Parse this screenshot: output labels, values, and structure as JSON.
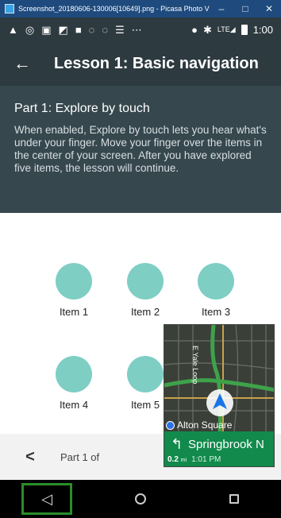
{
  "window": {
    "title": "Screenshot_20180606-130006[10649].png - Picasa Photo Viewer",
    "minimize_glyph": "–",
    "maximize_glyph": "□",
    "close_glyph": "✕"
  },
  "status_bar": {
    "icons": [
      "navigation-icon",
      "chrome-icon",
      "gmail-icon",
      "image-icon",
      "flag-icon",
      "location-icon",
      "location-icon",
      "keyboard-icon",
      "more-icon",
      "location-pin-icon",
      "bluetooth-icon",
      "signal-icon",
      "battery-icon"
    ],
    "lte": "LTE",
    "time": "1:00"
  },
  "toolbar": {
    "title": "Lesson 1: Basic navigation",
    "back_glyph": "←"
  },
  "lesson": {
    "heading": "Part 1: Explore by touch",
    "body": "When enabled, Explore by touch lets you hear what's under your finger. Move your finger over the items in the center of your screen. After you have explored five items, the lesson will continue."
  },
  "items": [
    {
      "label": "Item 1"
    },
    {
      "label": "Item 2"
    },
    {
      "label": "Item 3"
    },
    {
      "label": "Item 4"
    },
    {
      "label": "Item 5"
    }
  ],
  "pager": {
    "prev_glyph": "<",
    "text": "Part 1 of"
  },
  "navbar": {
    "back_glyph": "◁"
  },
  "map_overlay": {
    "road_label": "E Yale Loop",
    "place": "Alton Square",
    "street": "Springbrook N",
    "distance": "0.2",
    "distance_unit": "mi",
    "time": "1:01 PM",
    "turn_glyph": "↰",
    "colors": {
      "route": "#3ea24a",
      "card": "#118a4c",
      "arrow": "#1a73e8"
    }
  },
  "colors": {
    "toolbar": "#2d3a40",
    "panel": "#36474e",
    "item_circle": "#7ecec4",
    "active_nav_outline": "#2a8d2a"
  }
}
